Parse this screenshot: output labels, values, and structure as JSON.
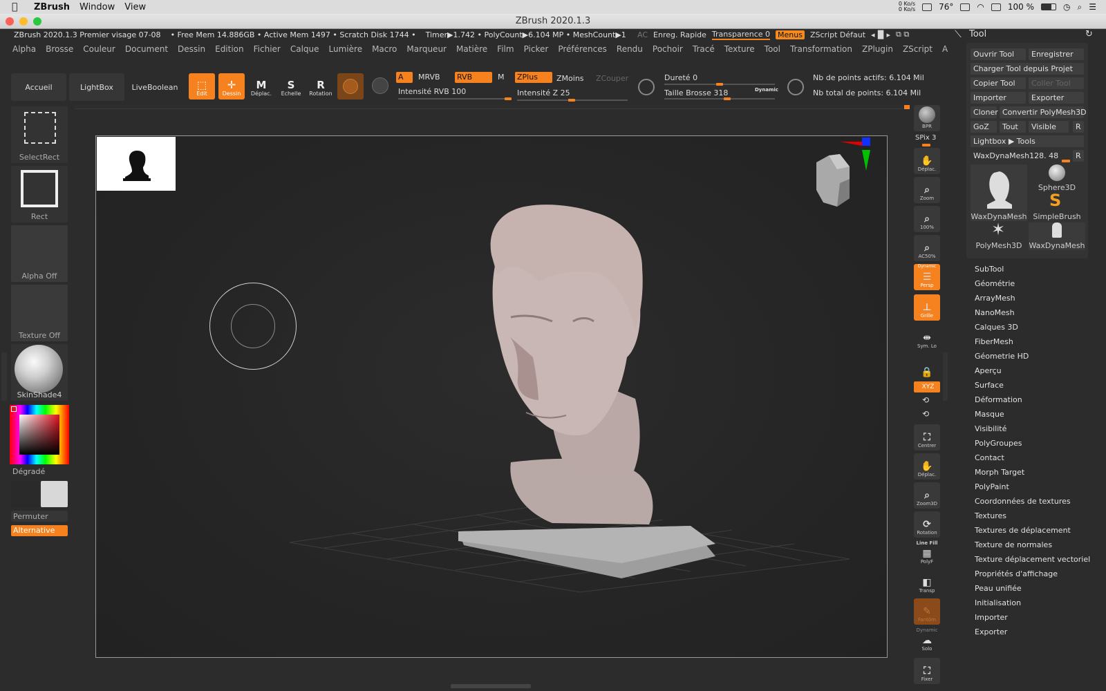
{
  "mac_menubar": {
    "app_name": "ZBrush",
    "items": [
      "Window",
      "View"
    ],
    "status": {
      "net_up": "0 Ko/s",
      "net_down": "0 Ko/s",
      "temperature": "76°",
      "battery": "100 %"
    }
  },
  "window": {
    "title": "ZBrush 2020.1.3"
  },
  "info_bar": {
    "document": "ZBrush 2020.1.3 Premier visage 07-08",
    "mem": "• Free Mem 14.886GB • Active Mem 1497 • Scratch Disk 1744 •",
    "timer": "Timer▶1.742 • PolyCount▶6.104 MP • MeshCount▶1",
    "ac": "AC",
    "quicksave": "Enreg. Rapide",
    "transparence": "Transparence 0",
    "menus": "Menus",
    "zscript": "ZScript Défaut"
  },
  "menu": [
    "Alpha",
    "Brosse",
    "Couleur",
    "Document",
    "Dessin",
    "Edition",
    "Fichier",
    "Calque",
    "Lumière",
    "Macro",
    "Marqueur",
    "Matière",
    "Film",
    "Picker",
    "Préférences",
    "Rendu",
    "Pochoir",
    "Tracé",
    "Texture",
    "Tool",
    "Transformation",
    "ZPlugin",
    "ZScript",
    "Aide"
  ],
  "toolbar": {
    "accueil": "Accueil",
    "lightbox": "LightBox",
    "liveboolean": "LiveBoolean",
    "edit": "Edit",
    "dessin": "Dessin",
    "deplac": "Déplac.",
    "echelle": "Echelle",
    "rotation": "Rotation",
    "a_label": "A",
    "mrvb": "MRVB",
    "rvb": "RVB",
    "m": "M",
    "intensite_rvb": "Intensité RVB 100",
    "zplus": "ZPlus",
    "zmoins": "ZMoins",
    "zcouper": "ZCouper",
    "intensite_z": "Intensité Z 25",
    "durete": "Dureté 0",
    "taille_brosse": "Taille Brosse 318",
    "dynamic": "Dynamic",
    "points_actifs": "Nb de points actifs: 6.104 Mil",
    "points_total": "Nb total de points: 6.104 Mil"
  },
  "left_shelf": {
    "selectrect": "SelectRect",
    "rect": "Rect",
    "alpha": "Alpha Off",
    "texture": "Texture Off",
    "material": "SkinShade4",
    "gradient": "Dégradé",
    "permuter": "Permuter",
    "alternative": "Alternative"
  },
  "right_shelf": {
    "bpr": "BPR",
    "spix": "SPix 3",
    "deplac": "Déplac.",
    "zoom": "Zoom",
    "p100": "100%",
    "ac50": "AC50%",
    "dynamic": "Dynamic",
    "persp": "Persp",
    "grille": "Grille",
    "symlo": "Sym. Lo",
    "xyz": "XYZ",
    "centrer": "Centrer",
    "deplac2": "Déplac.",
    "zoom3d": "Zoom3D",
    "rotation": "Rotation",
    "linefill": "Line Fill",
    "polyf": "PolyF",
    "transp": "Transp",
    "fantom": "Fantôm",
    "dynamic2": "Dynamic",
    "solo": "Solo",
    "fixer": "Fixer"
  },
  "tool_panel": {
    "title": "Tool",
    "buttons": {
      "ouvrir": "Ouvrir Tool",
      "enregistrer": "Enregistrer",
      "charger": "Charger Tool depuis Projet",
      "copier": "Copier Tool",
      "coller": "Coller Tool",
      "importer": "Importer",
      "exporter": "Exporter",
      "cloner": "Cloner",
      "convertir": "Convertir PolyMesh3D",
      "goz": "GoZ",
      "tout": "Tout",
      "visible": "Visible",
      "r": "R",
      "lightbox_tools": "Lightbox ▶ Tools",
      "current": "WaxDynaMesh128. 48",
      "r2": "R"
    },
    "thumbs": [
      "WaxDynaMesh",
      "Sphere3D",
      "SimpleBrush",
      "PolyMesh3D",
      "WaxDynaMesh"
    ],
    "subpalettes": [
      "SubTool",
      "Géométrie",
      "ArrayMesh",
      "NanoMesh",
      "Calques 3D",
      "FiberMesh",
      "Géometrie HD",
      "Aperçu",
      "Surface",
      "Déformation",
      "Masque",
      "Visibilité",
      "PolyGroupes",
      "Contact",
      "Morph Target",
      "PolyPaint",
      "Coordonnées de textures",
      "Textures",
      "Textures de déplacement",
      "Texture de normales",
      "Texture déplacement vectoriel",
      "Propriétés d'affichage",
      "Peau unifiée",
      "Initialisation",
      "Importer",
      "Exporter"
    ]
  },
  "colors": {
    "accent": "#f5821f",
    "bg": "#2c2c2c",
    "panel": "#333333"
  }
}
